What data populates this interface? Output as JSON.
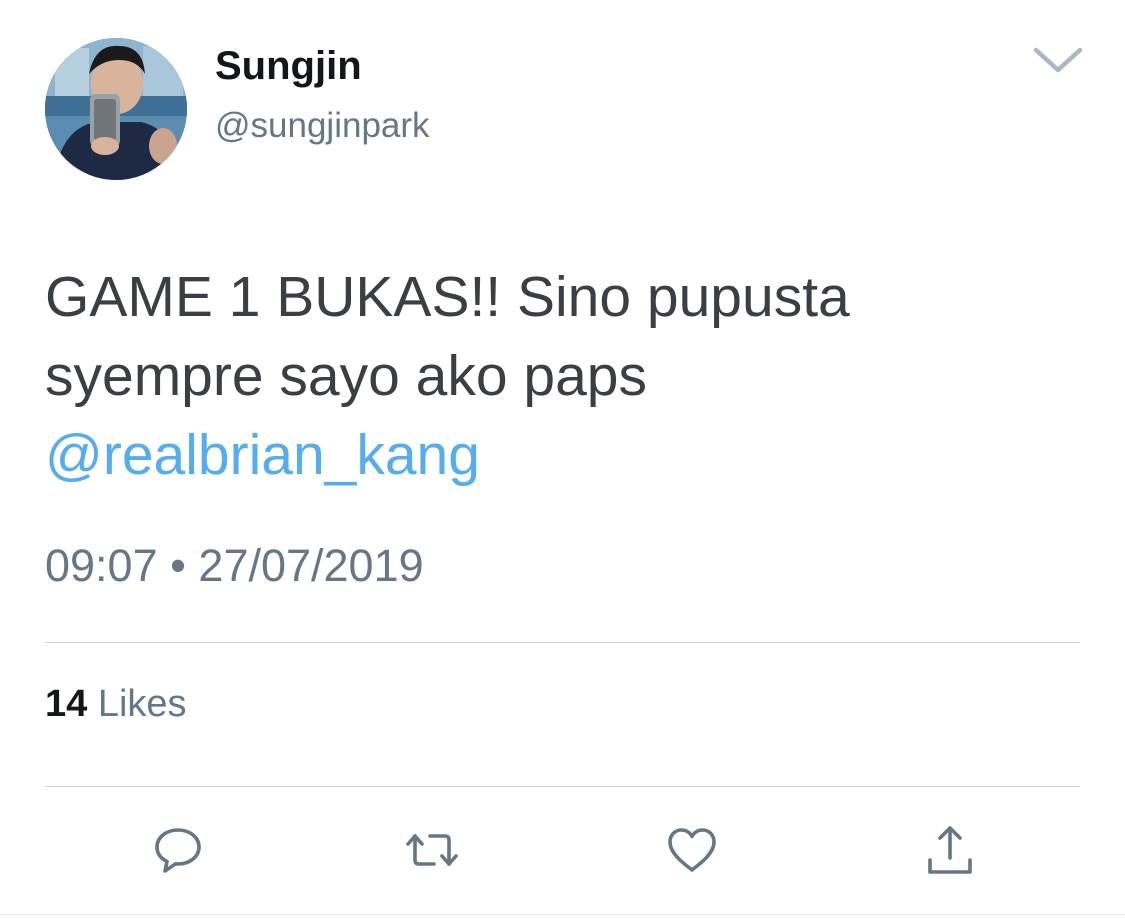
{
  "tweet": {
    "author": {
      "display_name": "Sungjin",
      "handle": "@sungjinpark",
      "avatar_icon": "profile-photo"
    },
    "text_lines": [
      "GAME 1 BUKAS!! Sino pupusta",
      "syempre sayo ako paps"
    ],
    "mention": "@realbrian_kang",
    "time": "09:07",
    "separator": "•",
    "date": "27/07/2019",
    "likes_count": "14",
    "likes_label": "Likes"
  },
  "actions": [
    {
      "name": "reply",
      "icon": "speech-bubble-icon"
    },
    {
      "name": "retweet",
      "icon": "retweet-arrows-icon"
    },
    {
      "name": "like",
      "icon": "heart-icon"
    },
    {
      "name": "share",
      "icon": "share-arrow-icon"
    }
  ],
  "colors": {
    "text_primary": "#14171a",
    "text_body": "#3b3f44",
    "text_secondary": "#657786",
    "link": "#55acee",
    "divider": "#ccd6dd",
    "icon": "#657786"
  }
}
